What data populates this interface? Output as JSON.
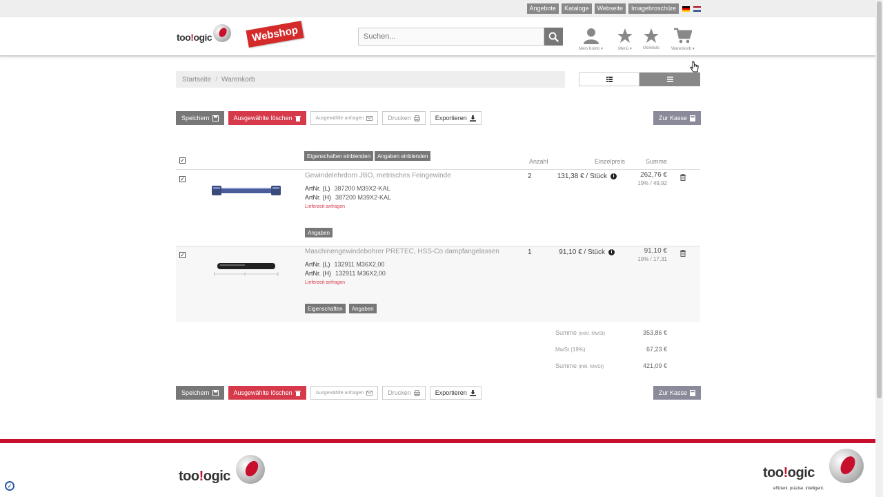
{
  "topbar": {
    "links": [
      "Angebote",
      "Kataloge",
      "Webseite",
      "Imagebroschüre"
    ],
    "languages": [
      "de-flag-icon",
      "nl-flag-icon"
    ]
  },
  "header": {
    "logo_part1": "too",
    "logo_accent": "!",
    "logo_part2": "ogic",
    "webshop_label": "Webshop",
    "search_placeholder": "Suchen...",
    "icons": {
      "account_label": "Mein Konto",
      "menu_label": "Menü",
      "wishlist_label": "Merkliste",
      "cart_label": "Warenkorb"
    }
  },
  "breadcrumb": {
    "home": "Startseite",
    "separator": "/",
    "current": "Warenkorb"
  },
  "actions": {
    "save": "Speichern",
    "delete_selected": "Ausgewählte löschen",
    "request_selected": "Ausgewählte anfragen",
    "print": "Drucken",
    "export": "Exportieren",
    "checkout": "Zur Kasse"
  },
  "table": {
    "show_properties": "Eigenschaften einblenden",
    "show_details": "Angaben einblenden",
    "col_quantity": "Anzahl",
    "col_unit_price": "Einzelpreis",
    "col_total": "Summe"
  },
  "items": [
    {
      "name": "Gewindelehrdorn JBO, metrisches Feingewinde",
      "art_l_label": "ArtNr. (L)",
      "art_l": "387200 M39X2-KAL",
      "art_h_label": "ArtNr. (H)",
      "art_h": "387200 M39X2-KAL",
      "delivery": "Lieferzeit anfragen",
      "quantity": "2",
      "unit_price": "131,38 € / Stück",
      "total": "262,76 €",
      "tax": "19% / 49,92",
      "buttons": [
        "Angaben"
      ],
      "checked": true
    },
    {
      "name": "Maschinengewindebohrer PRETEC, HSS-Co dampfangelassen",
      "art_l_label": "ArtNr. (L)",
      "art_l": "132911 M36X2,00",
      "art_h_label": "ArtNr. (H)",
      "art_h": "132911 M36X2,00",
      "delivery": "Lieferzeit anfragen",
      "quantity": "1",
      "unit_price": "91,10 € / Stück",
      "total": "91,10 €",
      "tax": "19% / 17,31",
      "buttons": [
        "Eigenschaften",
        "Angaben"
      ],
      "checked": true
    }
  ],
  "totals": {
    "net_label": "Summe",
    "net_sub": "(exkl. MwSt)",
    "net_value": "353,86 €",
    "vat_label": "MwSt (19%)",
    "vat_value": "67,23 €",
    "gross_label": "Summe",
    "gross_sub": "(inkl. MwSt)",
    "gross_value": "421,09 €"
  },
  "footer": {
    "tagline": "effizient. präzise. intelligent."
  },
  "colors": {
    "brand_red": "#c8102e",
    "delete_red": "#d63a4a",
    "button_gray": "#777777",
    "checkout_gray": "#8a8a9a"
  }
}
